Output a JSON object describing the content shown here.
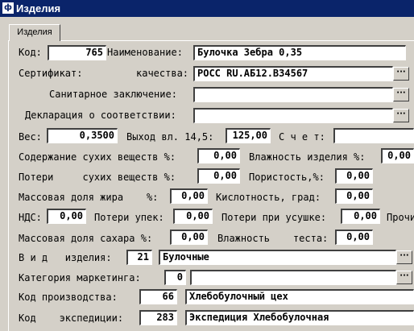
{
  "window": {
    "title": "Изделия",
    "icon": "app-icon"
  },
  "tabs": [
    {
      "label": "Изделия"
    }
  ],
  "form": {
    "code_label": "Код:",
    "code_value": "765",
    "name_label": "Наименование:",
    "name_value": "Булочка Зебра 0,35",
    "cert_label": "Сертификат:",
    "cert_quality_label": "качества:",
    "cert_value": "РОСС RU.АБ12.В34567",
    "sanitary_label": "Санитарное заключение:",
    "sanitary_value": "",
    "declaration_label": "Декларация о соответствии:",
    "declaration_value": "",
    "weight_label": "Вес:",
    "weight_value": "0,3500",
    "yield_label": "Выход вл. 14,5:",
    "yield_value": "125,00",
    "account_label": "С ч е т:",
    "account_value": "",
    "dry_content_label": "Содержание сухих веществ %:",
    "dry_content_value": "0,00",
    "humidity_label": "Влажность изделия %:",
    "humidity_value": "0,00",
    "dry_loss_label": "Потери     сухих веществ %:",
    "dry_loss_value": "0,00",
    "porosity_label": "Пористость,%:",
    "porosity_value": "0,00",
    "fat_label": "Массовая доля жира    %:",
    "fat_value": "0,00",
    "acidity_label": "Кислотность, град:",
    "acidity_value": "0,00",
    "vat_label": "НДС:",
    "vat_value": "0,00",
    "bake_loss_label": "Потери упек:",
    "bake_loss_value": "0,00",
    "shrink_loss_label": "Потери при усушке:",
    "shrink_loss_value": "0,00",
    "other_label": "Прочи",
    "sugar_label": "Массовая доля сахара %:",
    "sugar_value": "0,00",
    "dough_humidity_label": "Влажность    теста:",
    "dough_humidity_value": "0,00",
    "kind_label": "В и д   изделия:",
    "kind_code": "21",
    "kind_value": "Булочные",
    "marketing_label": "Категория маркетинга:",
    "marketing_code": "0",
    "marketing_value": "",
    "production_label": "Код производства:",
    "production_code": "66",
    "production_value": "Хлебобулочный цех",
    "expedition_label": "Код    экспедиции:",
    "expedition_code": "283",
    "expedition_value": "Экспедиция Хлебобулочная"
  },
  "buttons": {
    "lookup_label": "···"
  }
}
